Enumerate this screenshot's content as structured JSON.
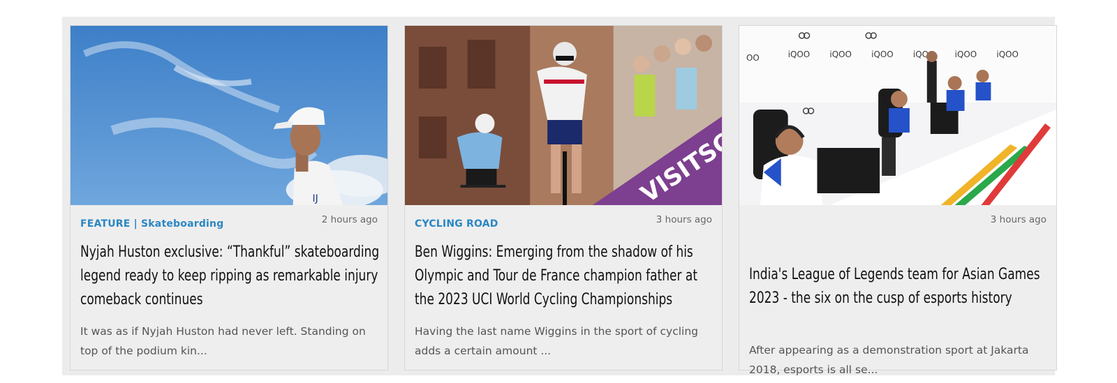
{
  "articles": [
    {
      "category": "FEATURE | Skateboarding",
      "time": "2 hours ago",
      "title": "Nyjah Huston exclusive: “Thankful” skateboarding legend ready to keep ripping as remarkable injury comeback continues",
      "excerpt": "It was as if Nyjah Huston had never left. Standing on top of the podium kin..."
    },
    {
      "category": "CYCLING ROAD",
      "time": "3 hours ago",
      "title": "Ben Wiggins: Emerging from the shadow of his Olympic and Tour de France champion father at the 2023 UCI World Cycling Championships",
      "excerpt": "Having the last name Wiggins in the sport of cycling adds a certain amount ..."
    },
    {
      "category": "",
      "time": "3 hours ago",
      "title": "India's League of Legends team for Asian Games 2023 - the six on the cusp of esports history",
      "excerpt": "After appearing as a demonstration sport at Jakarta 2018, esports is all se..."
    }
  ],
  "colors": {
    "category": "#2a87c4",
    "title": "#111111",
    "excerpt": "#555555",
    "card_bg": "#eeeeee"
  },
  "icons": [
    "skateboarder-photo",
    "cyclists-photo",
    "esports-arena-photo"
  ]
}
